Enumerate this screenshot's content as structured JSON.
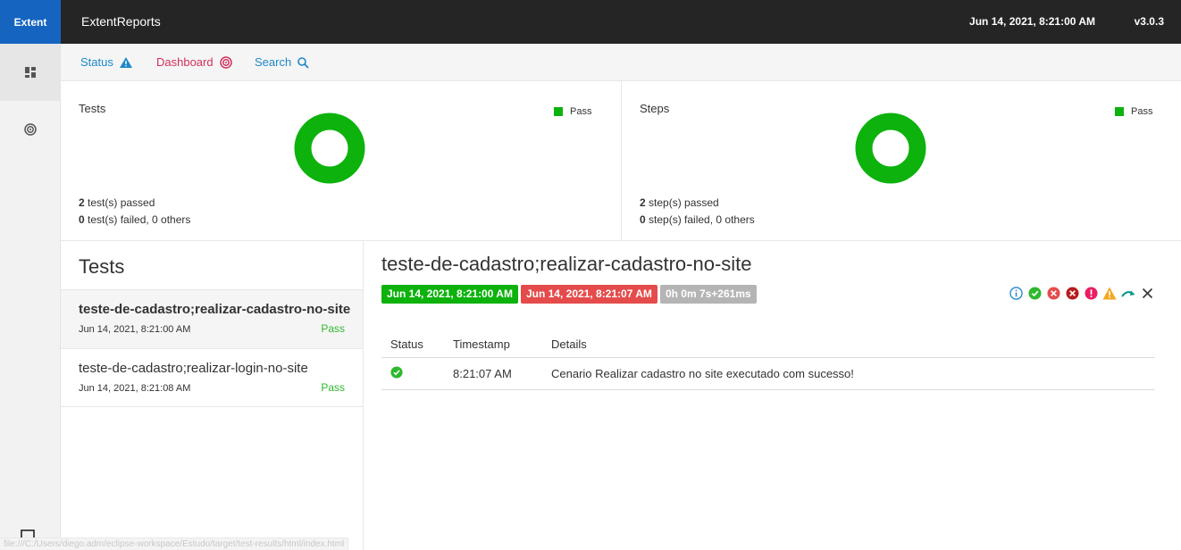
{
  "topbar": {
    "brand": "Extent",
    "title": "ExtentReports",
    "date": "Jun 14, 2021, 8:21:00 AM",
    "version": "v3.0.3"
  },
  "sidenav": {
    "items": [
      {
        "icon": "dashboard-grid-icon"
      },
      {
        "icon": "target-icon"
      }
    ],
    "bottom_icon": "monitor-icon"
  },
  "subnav": {
    "status_label": "Status",
    "dashboard_label": "Dashboard",
    "search_label": "Search",
    "status_color": "#1e88c8",
    "dashboard_color": "#d32f5c"
  },
  "dashboard": {
    "tests": {
      "title": "Tests",
      "legend": "Pass",
      "passed_count": "2",
      "passed_text": " test(s) passed",
      "failed_count": "0",
      "failed_text": " test(s) failed, 0 others",
      "pass_fraction": 1.0
    },
    "steps": {
      "title": "Steps",
      "legend": "Pass",
      "passed_count": "2",
      "passed_text": " step(s) passed",
      "failed_count": "0",
      "failed_text": " step(s) failed, 0 others",
      "pass_fraction": 1.0
    },
    "pass_color": "#0db20d"
  },
  "testlist": {
    "title": "Tests",
    "items": [
      {
        "name": "teste-de-cadastro;realizar-cadastro-no-site",
        "time": "Jun 14, 2021, 8:21:00 AM",
        "status": "Pass"
      },
      {
        "name": "teste-de-cadastro;realizar-login-no-site",
        "time": "Jun 14, 2021, 8:21:08 AM",
        "status": "Pass"
      }
    ]
  },
  "detail": {
    "title": "teste-de-cadastro;realizar-cadastro-no-site",
    "start": "Jun 14, 2021, 8:21:00 AM",
    "end": "Jun 14, 2021, 8:21:07 AM",
    "duration": "0h 0m 7s+261ms",
    "filters": [
      "info-icon",
      "pass-icon",
      "fail-icon",
      "fatal-icon",
      "error-icon",
      "warning-icon",
      "skip-icon",
      "clear-filter-icon"
    ],
    "columns": {
      "status": "Status",
      "timestamp": "Timestamp",
      "details": "Details"
    },
    "logs": [
      {
        "status_icon": "pass-check-icon",
        "timestamp": "8:21:07 AM",
        "details": "Cenario Realizar cadastro no site executado com sucesso!"
      }
    ]
  },
  "statusbar": {
    "url": "file:///C:/Users/diego.adm/eclipse-workspace/Estudo/target/test-results/html/index.html"
  }
}
